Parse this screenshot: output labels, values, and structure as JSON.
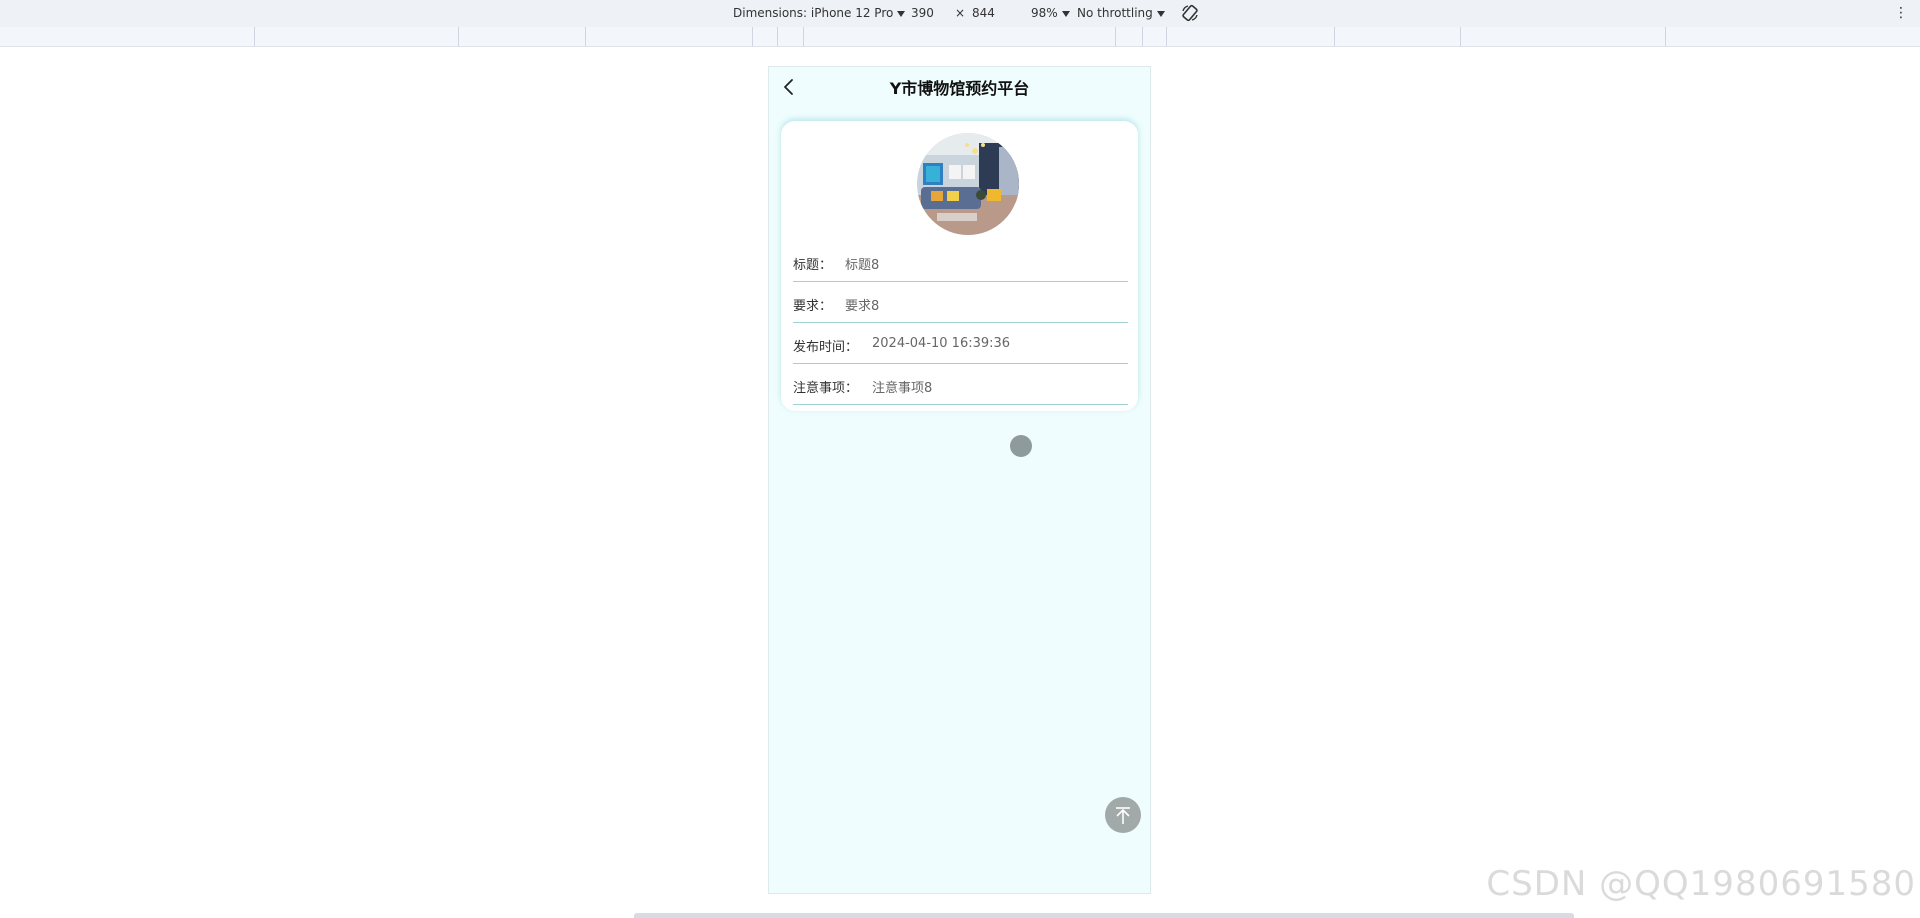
{
  "devtools": {
    "dimensions_label": "Dimensions: iPhone 12 Pro",
    "width": "390",
    "times": "×",
    "height": "844",
    "zoom": "98%",
    "throttling": "No throttling",
    "rotate_icon": "rotate-icon",
    "more_icon": "kebab-menu-icon"
  },
  "app": {
    "title": "Y市博物馆预约平台",
    "back_icon": "chevron-left-icon"
  },
  "detail": {
    "rows": [
      {
        "label": "标题：",
        "value": "标题8"
      },
      {
        "label": "要求：",
        "value": "要求8"
      },
      {
        "label": "发布时间：",
        "value": "2024-04-10 16:39:36"
      },
      {
        "label": "注意事项：",
        "value": "注意事项8"
      }
    ]
  },
  "watermark": "CSDN @QQ1980691580",
  "colors": {
    "page_bg": "#effdfe",
    "divider": "#9fd1d6",
    "accent_gray": "#a1a9a9"
  }
}
